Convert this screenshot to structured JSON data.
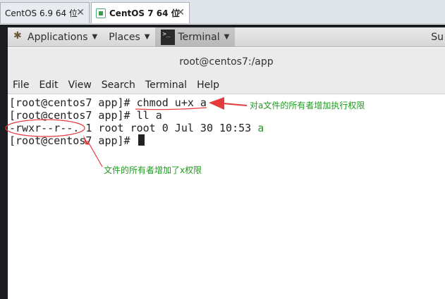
{
  "vm_tabs": [
    {
      "label": "CentOS 6.9 64 位",
      "active": false
    },
    {
      "label": "CentOS 7  64 位",
      "active": true
    }
  ],
  "panel": {
    "applications": "Applications",
    "places": "Places",
    "terminal": "Terminal",
    "right_cut": "Su"
  },
  "window": {
    "title": "root@centos7:/app"
  },
  "menubar": [
    "File",
    "Edit",
    "View",
    "Search",
    "Terminal",
    "Help"
  ],
  "terminal": {
    "line1_prompt": "[root@centos7 app]# ",
    "line1_cmd": "chmod u+x a",
    "line2": "[root@centos7 app]# ll a",
    "line3_prefix": "-rwxr--r--. 1 root root 0 Jul 30 10:53 ",
    "line3_file": "a",
    "line4_prompt": "[root@centos7 app]# "
  },
  "annotations": {
    "note1": "对a文件的所有者增加执行权限",
    "note2": "文件的所有者增加了x权限"
  },
  "colors": {
    "annotation_text": "#1e9b1e",
    "annotation_marks": "#e53b3b",
    "exec_file": "#2a9a2a"
  }
}
